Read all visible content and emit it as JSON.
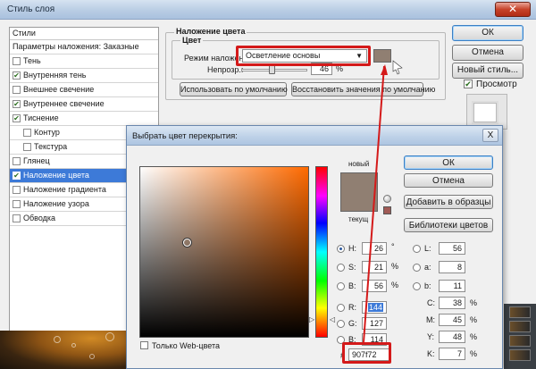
{
  "layer_style": {
    "title": "Стиль слоя",
    "styles_header": "Стили",
    "blending_options": "Параметры наложения: Заказные",
    "items": [
      {
        "label": "Тень",
        "checked": false,
        "indent": false
      },
      {
        "label": "Внутренняя тень",
        "checked": true,
        "indent": false
      },
      {
        "label": "Внешнее свечение",
        "checked": false,
        "indent": false
      },
      {
        "label": "Внутреннее свечение",
        "checked": true,
        "indent": false
      },
      {
        "label": "Тиснение",
        "checked": true,
        "indent": false
      },
      {
        "label": "Контур",
        "checked": false,
        "indent": true
      },
      {
        "label": "Текстура",
        "checked": false,
        "indent": true
      },
      {
        "label": "Глянец",
        "checked": false,
        "indent": false
      },
      {
        "label": "Наложение цвета",
        "checked": true,
        "indent": false,
        "selected": true
      },
      {
        "label": "Наложение градиента",
        "checked": false,
        "indent": false
      },
      {
        "label": "Наложение узора",
        "checked": false,
        "indent": false
      },
      {
        "label": "Обводка",
        "checked": false,
        "indent": false
      }
    ],
    "overlay_group": "Наложение цвета",
    "color_group": "Цвет",
    "blend_mode_label": "Режим наложения:",
    "blend_mode_value": "Осветление основы",
    "opacity_label": "Непрозр.:",
    "opacity_value": "46",
    "opacity_unit": "%",
    "opacity_fraction": 0.46,
    "swatch_color": "#907f72",
    "make_default": "Использовать по умолчанию",
    "reset_default": "Восстановить значения по умолчанию",
    "ok": "ОК",
    "cancel": "Отмена",
    "new_style": "Новый стиль...",
    "preview_label": "Просмотр",
    "preview_checked": true
  },
  "picker": {
    "title": "Выбрать цвет перекрытия:",
    "new_label": "новый",
    "current_label": "текущ",
    "new_color": "#907f72",
    "current_color": "#907f72",
    "ok": "ОК",
    "cancel": "Отмена",
    "add_swatches": "Добавить в образцы",
    "libraries": "Библиотеки цветов",
    "h_label": "H:",
    "h_value": "26",
    "h_unit": "°",
    "s_label": "S:",
    "s_value": "21",
    "s_unit": "%",
    "b_label": "B:",
    "b_value": "56",
    "b_unit": "%",
    "r_label": "R:",
    "r_value": "144",
    "g_label": "G:",
    "g_value": "127",
    "bb_label": "B:",
    "bb_value": "114",
    "l_label": "L:",
    "l_value": "56",
    "a_label": "a:",
    "a_value": "8",
    "lb_label": "b:",
    "lb_value": "11",
    "c_label": "C:",
    "c_value": "38",
    "c_unit": "%",
    "m_label": "M:",
    "m_value": "45",
    "m_unit": "%",
    "y_label": "Y:",
    "y_value": "48",
    "y_unit": "%",
    "k_label": "K:",
    "k_value": "7",
    "k_unit": "%",
    "hex_label": "#",
    "hex_value": "907f72",
    "web_only": "Только Web-цвета",
    "close_glyph": "X"
  },
  "accent_red": "#d41a1a",
  "selection_blue": "#3d7ad8"
}
